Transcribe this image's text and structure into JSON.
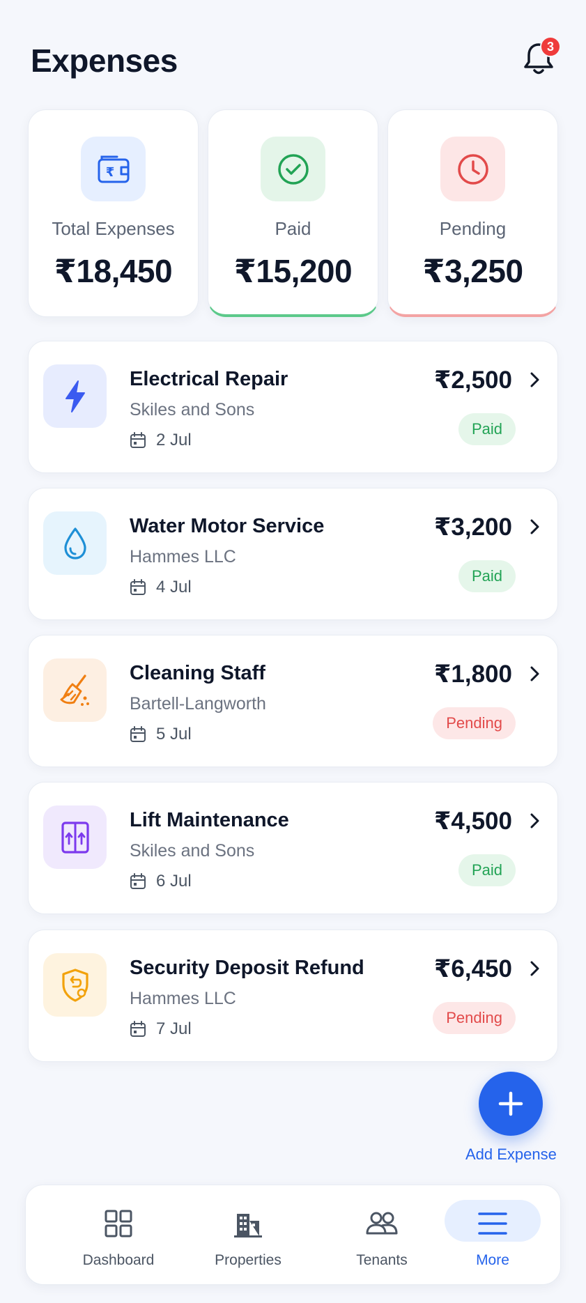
{
  "header": {
    "title": "Expenses",
    "notifications_count": "3"
  },
  "summary": {
    "total": {
      "label": "Total Expenses",
      "value": "₹18,450",
      "icon": "wallet-rupee-icon",
      "color": "#2563eb"
    },
    "paid": {
      "label": "Paid",
      "value": "₹15,200",
      "icon": "check-circle-icon",
      "color": "#22a355"
    },
    "pending": {
      "label": "Pending",
      "value": "₹3,250",
      "icon": "clock-icon",
      "color": "#e24a4a"
    }
  },
  "expenses": [
    {
      "title": "Electrical Repair",
      "vendor": "Skiles and Sons",
      "date": "2 Jul",
      "amount": "₹2,500",
      "status": "Paid",
      "icon": "lightning-icon"
    },
    {
      "title": "Water Motor Service",
      "vendor": "Hammes LLC",
      "date": "4 Jul",
      "amount": "₹3,200",
      "status": "Paid",
      "icon": "water-drop-icon"
    },
    {
      "title": "Cleaning Staff",
      "vendor": "Bartell-Langworth",
      "date": "5 Jul",
      "amount": "₹1,800",
      "status": "Pending",
      "icon": "broom-icon"
    },
    {
      "title": "Lift Maintenance",
      "vendor": "Skiles and Sons",
      "date": "6 Jul",
      "amount": "₹4,500",
      "status": "Paid",
      "icon": "elevator-icon"
    },
    {
      "title": "Security Deposit Refund",
      "vendor": "Hammes LLC",
      "date": "7 Jul",
      "amount": "₹6,450",
      "status": "Pending",
      "icon": "shield-refund-icon"
    }
  ],
  "fab": {
    "label": "Add Expense"
  },
  "nav": {
    "items": [
      {
        "label": "Dashboard",
        "icon": "grid-icon"
      },
      {
        "label": "Properties",
        "icon": "building-icon"
      },
      {
        "label": "Tenants",
        "icon": "users-icon"
      },
      {
        "label": "More",
        "icon": "menu-icon",
        "active": true
      }
    ]
  },
  "colors": {
    "accent": "#2563eb",
    "paid": "#22a355",
    "pending": "#e24a4a",
    "background": "#f5f7fc"
  }
}
